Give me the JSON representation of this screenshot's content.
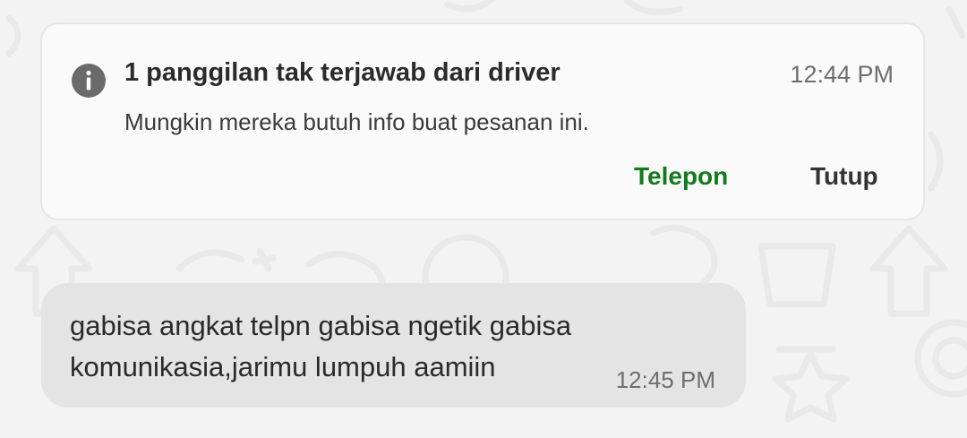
{
  "notification": {
    "icon": "info-icon",
    "title": "1 panggilan tak terjawab dari driver",
    "time": "12:44 PM",
    "description": "Mungkin mereka butuh info buat pesanan ini.",
    "call_label": "Telepon",
    "close_label": "Tutup",
    "accent_color": "#137a1e"
  },
  "message": {
    "text": "gabisa angkat telpn gabisa ngetik gabisa komunikasia,jarimu lumpuh aamiin",
    "time": "12:45 PM"
  }
}
